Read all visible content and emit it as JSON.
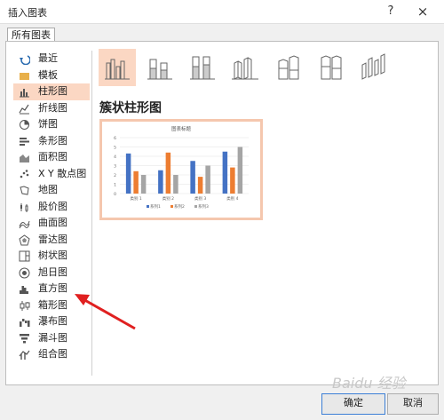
{
  "window": {
    "title": "插入图表",
    "help_icon": "?",
    "close_icon": "×"
  },
  "tab": {
    "label": "所有图表"
  },
  "sidebar": {
    "items": [
      {
        "label": "最近",
        "icon": "recent-icon"
      },
      {
        "label": "模板",
        "icon": "folder-icon"
      },
      {
        "label": "柱形图",
        "icon": "column-chart-icon",
        "selected": true
      },
      {
        "label": "折线图",
        "icon": "line-chart-icon"
      },
      {
        "label": "饼图",
        "icon": "pie-chart-icon"
      },
      {
        "label": "条形图",
        "icon": "bar-chart-icon"
      },
      {
        "label": "面积图",
        "icon": "area-chart-icon"
      },
      {
        "label": "X Y 散点图",
        "icon": "scatter-chart-icon"
      },
      {
        "label": "地图",
        "icon": "map-chart-icon"
      },
      {
        "label": "股价图",
        "icon": "stock-chart-icon"
      },
      {
        "label": "曲面图",
        "icon": "surface-chart-icon"
      },
      {
        "label": "雷达图",
        "icon": "radar-chart-icon"
      },
      {
        "label": "树状图",
        "icon": "treemap-icon"
      },
      {
        "label": "旭日图",
        "icon": "sunburst-icon"
      },
      {
        "label": "直方图",
        "icon": "histogram-icon"
      },
      {
        "label": "箱形图",
        "icon": "box-whisker-icon"
      },
      {
        "label": "瀑布图",
        "icon": "waterfall-icon"
      },
      {
        "label": "漏斗图",
        "icon": "funnel-icon"
      },
      {
        "label": "组合图",
        "icon": "combo-chart-icon"
      }
    ]
  },
  "main": {
    "subtitle": "簇状柱形图"
  },
  "chart_data": {
    "type": "bar",
    "title": "图表标题",
    "categories": [
      "类别 1",
      "类别 2",
      "类别 3",
      "类别 4"
    ],
    "series": [
      {
        "name": "系列1",
        "values": [
          4.3,
          2.5,
          3.5,
          4.5
        ]
      },
      {
        "name": "系列2",
        "values": [
          2.4,
          4.4,
          1.8,
          2.8
        ]
      },
      {
        "name": "系列3",
        "values": [
          2,
          2,
          3,
          5
        ]
      }
    ],
    "colors": [
      "#4472c4",
      "#ed7d31",
      "#a5a5a5"
    ],
    "yticks": [
      "0",
      "1",
      "2",
      "3",
      "4",
      "5",
      "6"
    ],
    "ylim": [
      0,
      6
    ],
    "grid": true,
    "legend": "bottom"
  },
  "footer": {
    "ok": "确定",
    "cancel": "取消"
  },
  "watermark": "Baidu 经验"
}
